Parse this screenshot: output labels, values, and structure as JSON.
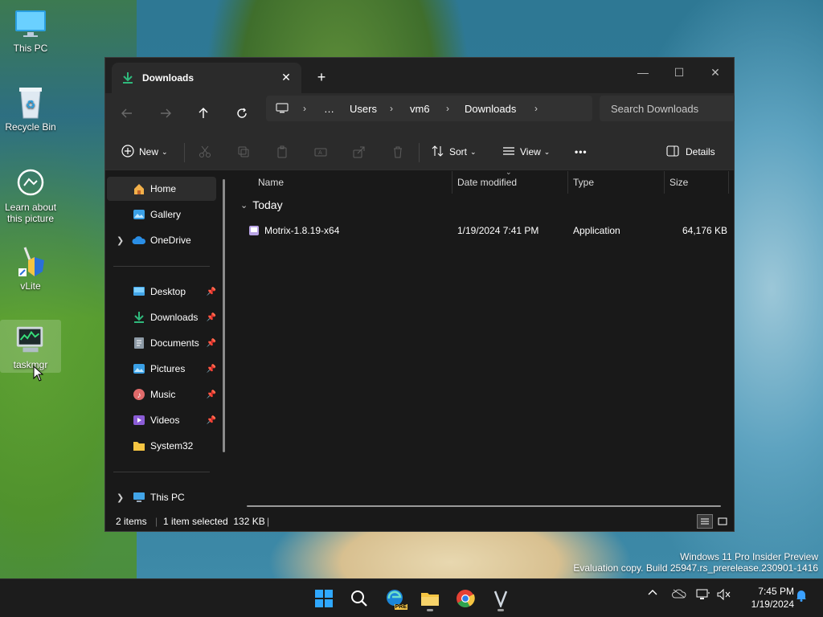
{
  "desktop": {
    "icons": [
      {
        "label": "This PC"
      },
      {
        "label": "Recycle Bin"
      },
      {
        "label": "Learn about this picture"
      },
      {
        "label": "vLite"
      },
      {
        "label": "taskmgr"
      }
    ],
    "watermark": {
      "line1": "Windows 11 Pro Insider Preview",
      "line2": "Evaluation copy. Build 25947.rs_prerelease.230901-1416"
    }
  },
  "window": {
    "tab_title": "Downloads",
    "tab_close": "✕",
    "new_tab": "+",
    "controls": {
      "minimize": "—",
      "maximize": "☐",
      "close": "✕"
    },
    "breadcrumbs": [
      "…",
      "Users",
      "vm6",
      "Downloads"
    ],
    "search_placeholder": "Search Downloads",
    "toolbar": {
      "new_label": "New",
      "sort_label": "Sort",
      "view_label": "View",
      "more_label": "•••",
      "details_label": "Details"
    },
    "nav": {
      "quick": [
        {
          "label": "Home"
        },
        {
          "label": "Gallery"
        },
        {
          "label": "OneDrive"
        }
      ],
      "pinned": [
        {
          "label": "Desktop"
        },
        {
          "label": "Downloads"
        },
        {
          "label": "Documents"
        },
        {
          "label": "Pictures"
        },
        {
          "label": "Music"
        },
        {
          "label": "Videos"
        },
        {
          "label": "System32"
        }
      ],
      "this_pc": "This PC"
    },
    "columns": {
      "name": "Name",
      "date": "Date modified",
      "type": "Type",
      "size": "Size"
    },
    "group": "Today",
    "files": [
      {
        "name": "Motrix-1.8.19-x64",
        "date": "1/19/2024 7:41 PM",
        "type": "Application",
        "size": "64,176 KB"
      }
    ],
    "status": {
      "count": "2 items",
      "selected": "1 item selected  132 KB",
      "sep": "|"
    }
  },
  "taskbar": {
    "edge_badge": "PRE",
    "time": "7:45 PM",
    "date": "1/19/2024"
  },
  "colors": {
    "window_bg": "#191919",
    "toolbar_bg": "#2b2b2b",
    "accent_green": "#2fb97c",
    "folder_yellow": "#f5c542"
  }
}
